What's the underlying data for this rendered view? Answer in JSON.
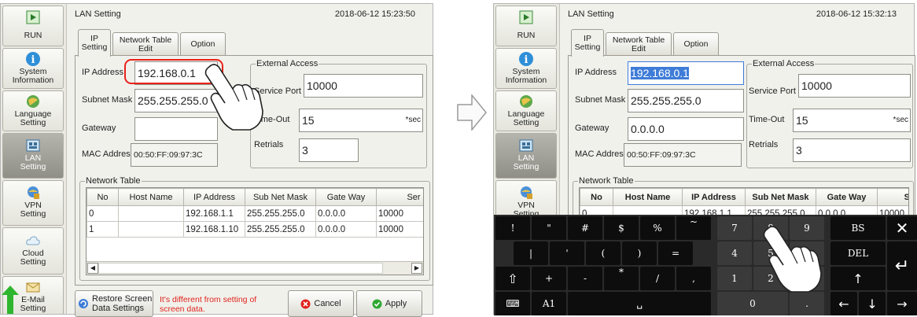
{
  "sidebar": {
    "items": [
      {
        "label": "RUN",
        "icon": "run-icon"
      },
      {
        "label": "System\nInformation",
        "icon": "info-icon"
      },
      {
        "label": "Language\nSetting",
        "icon": "language-icon"
      },
      {
        "label": "LAN\nSetting",
        "icon": "lan-icon"
      },
      {
        "label": "VPN\nSetting",
        "icon": "vpn-icon"
      },
      {
        "label": "Cloud\nSetting",
        "icon": "cloud-icon"
      },
      {
        "label": "E-Mail\nSetting",
        "icon": "email-icon"
      }
    ]
  },
  "left": {
    "title": "LAN Setting",
    "datetime": "2018-06-12 15:23:50",
    "tabs": [
      "IP\nSetting",
      "Network Table\nEdit",
      "Option"
    ],
    "ip_label": "IP Address",
    "ip_value": "192.168.0.1",
    "subnet_label": "Subnet Mask",
    "subnet_value": "255.255.255.0",
    "gateway_label": "Gateway",
    "gateway_value": "",
    "mac_label": "MAC Address",
    "mac_value": "00:50:FF:09:97:3C",
    "external_access": "External Access",
    "service_port_label": "Service Port",
    "service_port_value": "10000",
    "timeout_label": "Time-Out",
    "timeout_value": "15",
    "timeout_unit": "*sec",
    "retrials_label": "Retrials",
    "retrials_value": "3",
    "network_table": "Network Table",
    "columns": [
      "No",
      "Host Name",
      "IP Address",
      "Sub Net Mask",
      "Gate Way",
      "Ser"
    ],
    "rows": [
      [
        "0",
        "",
        "192.168.1.1",
        "255.255.255.0",
        "0.0.0.0",
        "10000"
      ],
      [
        "1",
        "",
        "192.168.1.10",
        "255.255.255.0",
        "0.0.0.0",
        "10000"
      ]
    ],
    "restore_label": "Restore Screen\nData Settings",
    "warning": "It's different from setting of\nscreen data.",
    "cancel_label": "Cancel",
    "apply_label": "Apply"
  },
  "right": {
    "title": "LAN Setting",
    "datetime": "2018-06-12 15:32:13",
    "tabs": [
      "IP\nSetting",
      "Network Table\nEdit",
      "Option"
    ],
    "ip_label": "IP Address",
    "ip_value": "192.168.0.1",
    "subnet_label": "Subnet Mask",
    "subnet_value": "255.255.255.0",
    "gateway_label": "Gateway",
    "gateway_value": "0.0.0.0",
    "mac_label": "MAC Address",
    "mac_value": "00:50:FF:09:97:3C",
    "external_access": "External Access",
    "service_port_label": "Service Port",
    "service_port_value": "10000",
    "timeout_label": "Time-Out",
    "timeout_value": "15",
    "timeout_unit": "*sec",
    "retrials_label": "Retrials",
    "retrials_value": "3",
    "network_table": "Network Table",
    "columns": [
      "No",
      "Host Name",
      "IP Address",
      "Sub Net Mask",
      "Gate Way",
      "Serv"
    ],
    "rows": [
      [
        "0",
        "",
        "192.168.1.1",
        "255.255.255.0",
        "0.0.0.0",
        "10000"
      ]
    ]
  },
  "keyboard": {
    "row1": [
      "!",
      "\"",
      "#",
      "$",
      "%",
      "~",
      "7",
      "8",
      "9",
      "BS",
      "✕"
    ],
    "row2": [
      "|",
      "'",
      "(",
      ")",
      "=",
      "4",
      "5",
      "6",
      "DEL",
      "↵"
    ],
    "row3": [
      "⇧",
      "+",
      "-",
      "*",
      "/",
      ",",
      "1",
      "2",
      "3",
      "↑"
    ],
    "row4": [
      "⌨",
      "A1",
      "␣",
      "0",
      ".",
      "←",
      "↓",
      "→"
    ]
  },
  "colors": {
    "highlight_ring": "#e8231a",
    "selection": "#3e7cd8",
    "warning_text": "#e0241c",
    "active_sidebar": "#9b9b94"
  }
}
